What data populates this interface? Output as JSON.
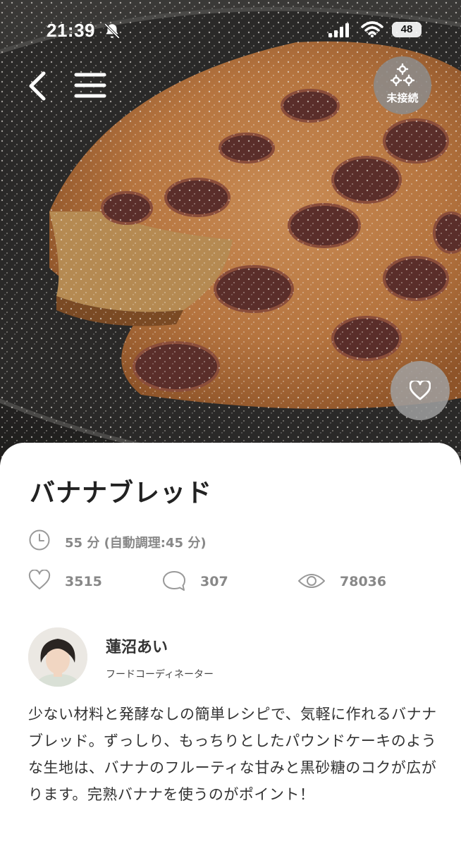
{
  "status_bar": {
    "time": "21:39",
    "battery": "48"
  },
  "hero": {
    "connect_label": "未接続"
  },
  "recipe": {
    "title": "バナナブレッド",
    "time": "55 分 (自動調理:45 分)",
    "likes": "3515",
    "comments": "307",
    "views": "78036"
  },
  "author": {
    "name": "蓮沼あい",
    "role": "フードコーディネーター"
  },
  "description": "少ない材料と発酵なしの簡単レシピで、気軽に作れるバナナブレッド。ずっしり、もっちりとしたパウンドケーキのような生地は、バナナのフルーティな甘みと黒砂糖のコクが広がります。完熟バナナを使うのがポイント！"
}
